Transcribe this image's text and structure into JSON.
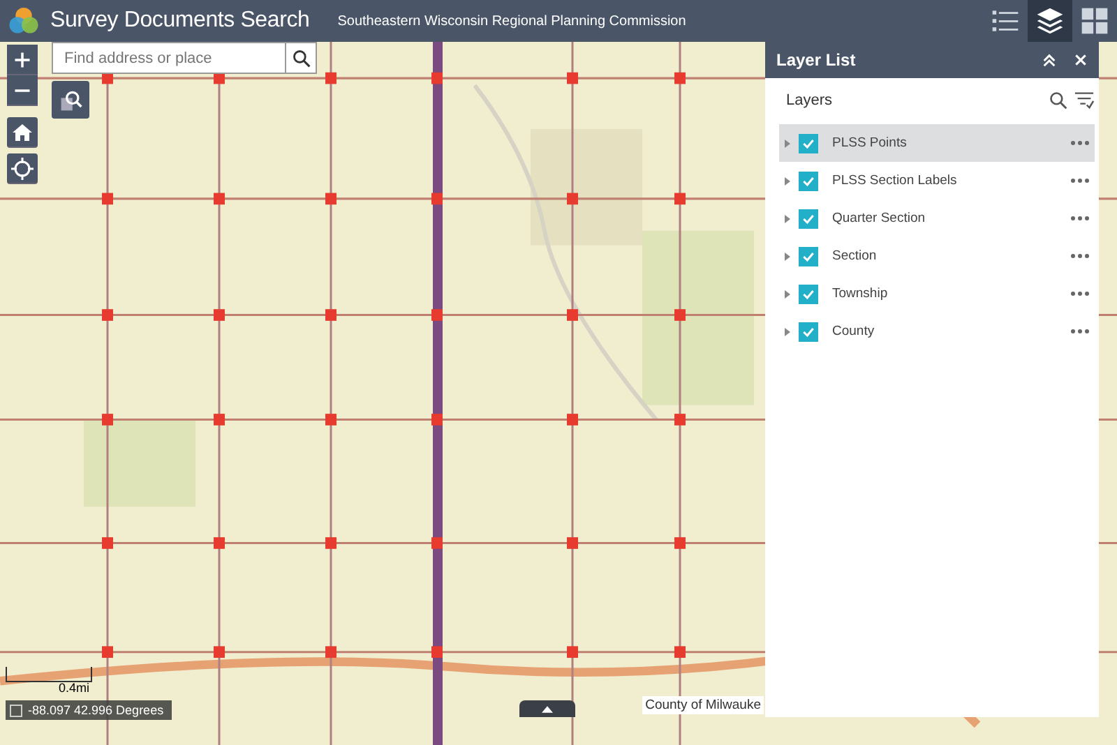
{
  "header": {
    "title": "Survey Documents Search",
    "subtitle": "Southeastern Wisconsin Regional Planning Commission",
    "tools": [
      {
        "kind": "list",
        "selected": false
      },
      {
        "kind": "layers",
        "selected": true
      },
      {
        "kind": "grid",
        "selected": false
      }
    ]
  },
  "search": {
    "placeholder": "Find address or place"
  },
  "layer_panel": {
    "title": "Layer List",
    "heading": "Layers",
    "layers": [
      {
        "label": "PLSS Points",
        "checked": true,
        "selected": true
      },
      {
        "label": "PLSS Section Labels",
        "checked": true,
        "selected": false
      },
      {
        "label": "Quarter Section",
        "checked": true,
        "selected": false
      },
      {
        "label": "Section",
        "checked": true,
        "selected": false
      },
      {
        "label": "Township",
        "checked": true,
        "selected": false
      },
      {
        "label": "County",
        "checked": true,
        "selected": false
      }
    ]
  },
  "scale": {
    "label": "0.4mi"
  },
  "coordinates": "-88.097 42.996 Degrees",
  "attribution": "County of Milwauke"
}
